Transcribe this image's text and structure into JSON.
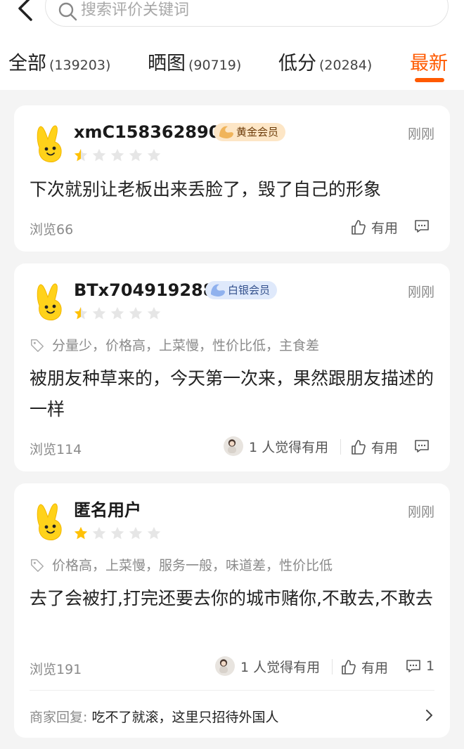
{
  "search": {
    "placeholder": "搜索评价关键词"
  },
  "tabs": [
    {
      "label": "全部",
      "count": "(139203)"
    },
    {
      "label": "晒图",
      "count": "(90719)"
    },
    {
      "label": "低分",
      "count": "(20284)"
    },
    {
      "label": "最新",
      "count": ""
    }
  ],
  "reviews": [
    {
      "user": "xmC158362890",
      "badge": "黄金会员",
      "badge_color": "#fde6c6",
      "time": "刚刚",
      "rating": 0.5,
      "tags": "",
      "text": "下次就别让老板出来丢脸了，毁了自己的形象",
      "views": "浏览66",
      "helpful_people": "",
      "useful_label": "有用",
      "comment_count": "",
      "reply_label": "",
      "reply_text": ""
    },
    {
      "user": "BTx704919288",
      "badge": "白银会员",
      "badge_color": "#dfe9fb",
      "time": "刚刚",
      "rating": 0.5,
      "tags": "分量少，价格高，上菜慢，性价比低，主食差",
      "text": "被朋友种草来的，今天第一次来，果然跟朋友描述的一样",
      "views": "浏览114",
      "helpful_people": "1 人觉得有用",
      "useful_label": "有用",
      "comment_count": "",
      "reply_label": "",
      "reply_text": ""
    },
    {
      "user": "匿名用户",
      "badge": "",
      "badge_color": "",
      "time": "刚刚",
      "rating": 1,
      "tags": "价格高，上菜慢，服务一般，味道差，性价比低",
      "text": "去了会被打,打完还要去你的城市赌你,不敢去,不敢去",
      "views": "浏览191",
      "helpful_people": "1 人觉得有用",
      "useful_label": "有用",
      "comment_count": "1",
      "reply_label": "商家回复:",
      "reply_text": "吃不了就滚，这里只招待外国人"
    }
  ],
  "colors": {
    "accent": "#ff5a00",
    "star": "#ffc107",
    "star_empty": "#e6e6e6"
  },
  "icons": [
    "back-arrow-icon",
    "search-icon",
    "mascot-avatar-icon",
    "star-icon",
    "tag-icon",
    "thumbs-up-icon",
    "comment-icon",
    "chevron-right-icon"
  ]
}
